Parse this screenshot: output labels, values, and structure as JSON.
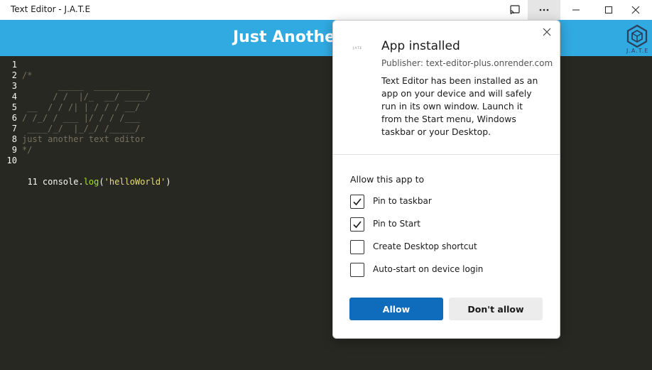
{
  "window": {
    "title": "Text Editor - J.A.T.E"
  },
  "header": {
    "heading": "Just Another Text Editor",
    "logo_text": "J.A.T.E"
  },
  "editor": {
    "lines": [
      {
        "n": "1",
        "kind": "tx",
        "text": ""
      },
      {
        "n": "2",
        "kind": "cm",
        "text": "/*"
      },
      {
        "n": "3",
        "kind": "cm",
        "text": "       _____  ___________"
      },
      {
        "n": "4",
        "kind": "cm",
        "text": "      / /  |/_  __/ ____/"
      },
      {
        "n": "5",
        "kind": "cm",
        "text": " __  / / /| | / / / __/"
      },
      {
        "n": "6",
        "kind": "cm",
        "text": "/ /_/ / ___ |/ / / /___"
      },
      {
        "n": "7",
        "kind": "cm",
        "text": " ____/_/  |_/_/ /_____/"
      },
      {
        "n": "8",
        "kind": "cm",
        "text": "just another text editor"
      },
      {
        "n": "9",
        "kind": "cm",
        "text": "*/"
      },
      {
        "n": "10",
        "kind": "tx",
        "text": ""
      }
    ],
    "line11": {
      "n": "11",
      "obj": "console.",
      "fn": "log",
      "open": "(",
      "str": "'helloWorld'",
      "close": ")"
    }
  },
  "popup": {
    "title": "App installed",
    "publisher": "Publisher: text-editor-plus.onrender.com",
    "description": "Text Editor has been installed as an app on your device and will safely run in its own window. Launch it from the Start menu, Windows taskbar or your Desktop.",
    "icon_text": "J.A.T.E",
    "allow_label": "Allow this app to",
    "options": [
      {
        "label": "Pin to taskbar",
        "checked": true
      },
      {
        "label": "Pin to Start",
        "checked": true
      },
      {
        "label": "Create Desktop shortcut",
        "checked": false
      },
      {
        "label": "Auto-start on device login",
        "checked": false
      }
    ],
    "allow_button": "Allow",
    "deny_button": "Don't allow"
  },
  "colors": {
    "header": "#31a9e1",
    "editor_bg": "#272822",
    "accent_button": "#0f6cbd"
  }
}
